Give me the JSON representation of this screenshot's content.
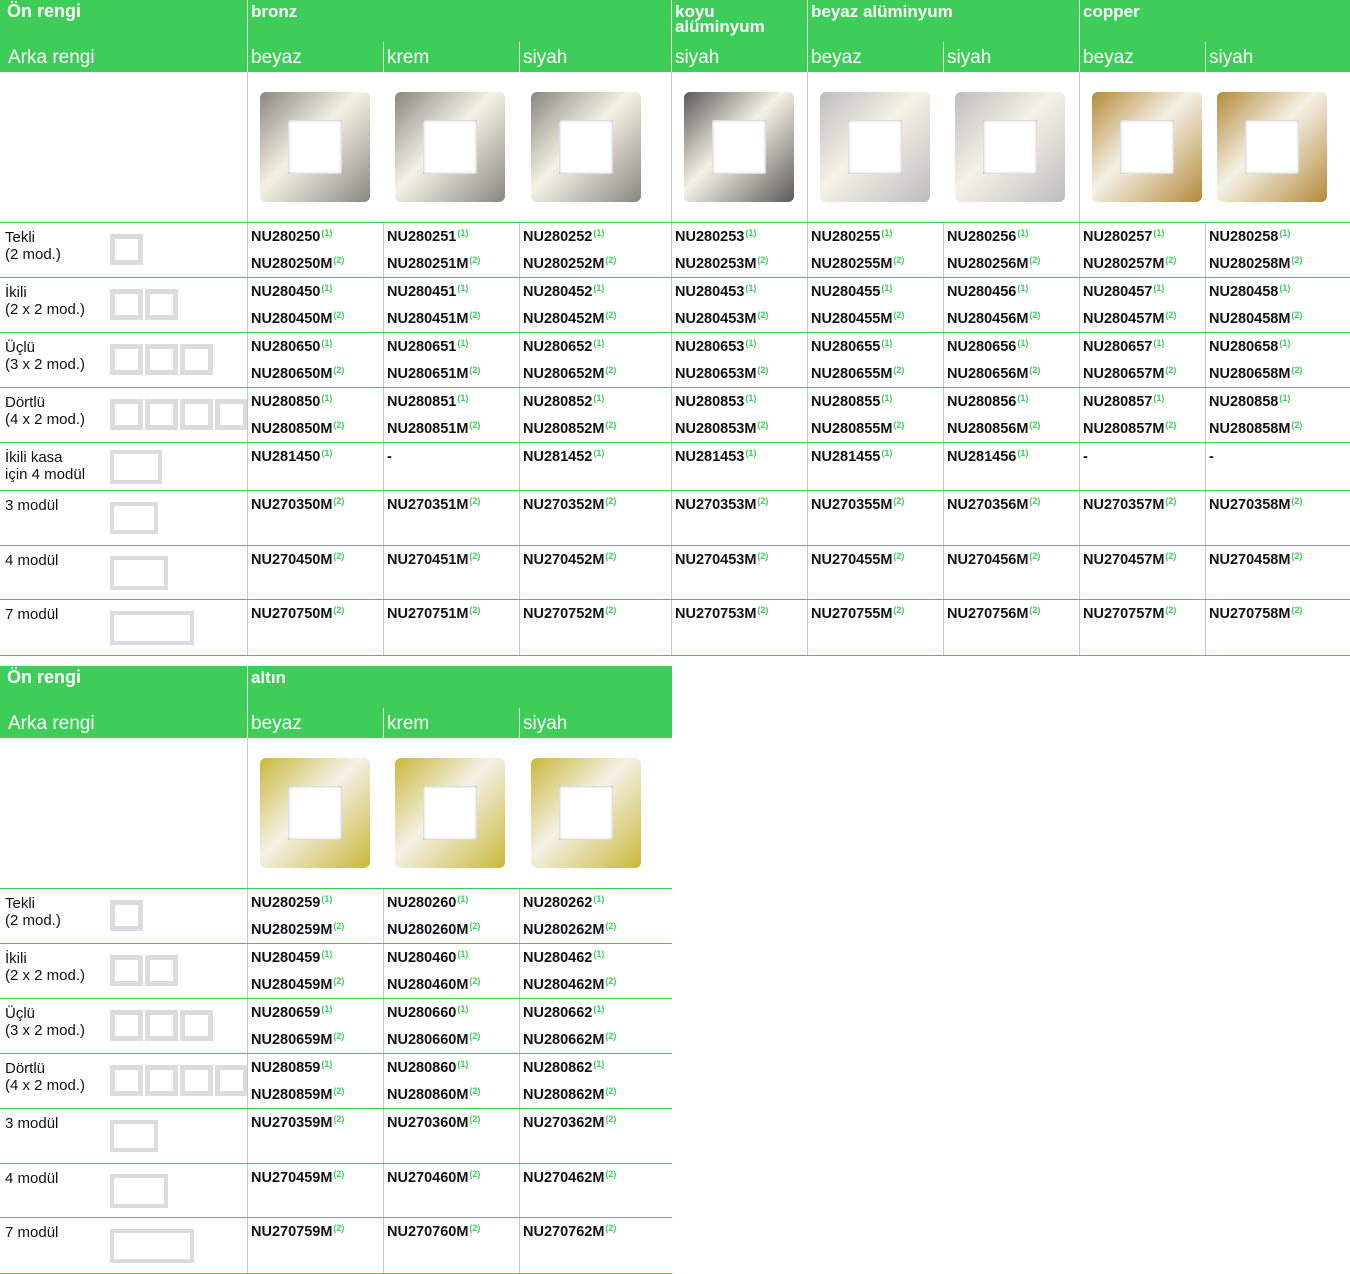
{
  "labels": {
    "front_color": "Ön rengi",
    "back_color": "Arka rengi"
  },
  "colors": {
    "brand_green": "#3dcd58",
    "bronze": "#8a8780",
    "dark_aluminium": "#5a5a57",
    "white_aluminium": "#bdbdbd",
    "copper": "#b58a3c",
    "gold": "#c8b83a"
  },
  "table1": {
    "groups": [
      {
        "name": "bronz",
        "subs": [
          "beyaz",
          "krem",
          "siyah"
        ]
      },
      {
        "name": "koyu alüminyum",
        "subs": [
          "siyah"
        ]
      },
      {
        "name": "beyaz alüminyum",
        "subs": [
          "beyaz",
          "siyah"
        ]
      },
      {
        "name": "copper",
        "subs": [
          "beyaz",
          "siyah"
        ]
      }
    ],
    "frames": [
      "bronze",
      "bronze",
      "bronze",
      "dark_aluminium",
      "white_aluminium",
      "white_aluminium",
      "copper",
      "copper"
    ],
    "rows": [
      {
        "label": "Tekli\n(2 mod.)",
        "icon": "module-icon-1x2",
        "codes": [
          [
            "NU280250",
            "NU280250M"
          ],
          [
            "NU280251",
            "NU280251M"
          ],
          [
            "NU280252",
            "NU280252M"
          ],
          [
            "NU280253",
            "NU280253M"
          ],
          [
            "NU280255",
            "NU280255M"
          ],
          [
            "NU280256",
            "NU280256M"
          ],
          [
            "NU280257",
            "NU280257M"
          ],
          [
            "NU280258",
            "NU280258M"
          ]
        ]
      },
      {
        "label": "İkili\n(2 x 2 mod.)",
        "icon": "module-icon-2x2",
        "codes": [
          [
            "NU280450",
            "NU280450M"
          ],
          [
            "NU280451",
            "NU280451M"
          ],
          [
            "NU280452",
            "NU280452M"
          ],
          [
            "NU280453",
            "NU280453M"
          ],
          [
            "NU280455",
            "NU280455M"
          ],
          [
            "NU280456",
            "NU280456M"
          ],
          [
            "NU280457",
            "NU280457M"
          ],
          [
            "NU280458",
            "NU280458M"
          ]
        ]
      },
      {
        "label": "Üçlü\n(3 x 2 mod.)",
        "icon": "module-icon-3x2",
        "codes": [
          [
            "NU280650",
            "NU280650M"
          ],
          [
            "NU280651",
            "NU280651M"
          ],
          [
            "NU280652",
            "NU280652M"
          ],
          [
            "NU280653",
            "NU280653M"
          ],
          [
            "NU280655",
            "NU280655M"
          ],
          [
            "NU280656",
            "NU280656M"
          ],
          [
            "NU280657",
            "NU280657M"
          ],
          [
            "NU280658",
            "NU280658M"
          ]
        ]
      },
      {
        "label": "Dörtlü\n(4 x 2 mod.)",
        "icon": "module-icon-4x2",
        "codes": [
          [
            "NU280850",
            "NU280850M"
          ],
          [
            "NU280851",
            "NU280851M"
          ],
          [
            "NU280852",
            "NU280852M"
          ],
          [
            "NU280853",
            "NU280853M"
          ],
          [
            "NU280855",
            "NU280855M"
          ],
          [
            "NU280856",
            "NU280856M"
          ],
          [
            "NU280857",
            "NU280857M"
          ],
          [
            "NU280858",
            "NU280858M"
          ]
        ]
      },
      {
        "label": "İkili kasa\niçin 4 modül",
        "icon": "module-icon-double-box",
        "codes": [
          [
            "NU281450"
          ],
          [
            "-"
          ],
          [
            "NU281452"
          ],
          [
            "NU281453"
          ],
          [
            "NU281455"
          ],
          [
            "NU281456"
          ],
          [
            "-"
          ],
          [
            "-"
          ]
        ]
      },
      {
        "label": "3 modül",
        "icon": "module-icon-3",
        "codes": [
          [
            "NU270350M"
          ],
          [
            "NU270351M"
          ],
          [
            "NU270352M"
          ],
          [
            "NU270353M"
          ],
          [
            "NU270355M"
          ],
          [
            "NU270356M"
          ],
          [
            "NU270357M"
          ],
          [
            "NU270358M"
          ]
        ]
      },
      {
        "label": "4 modül",
        "icon": "module-icon-4",
        "codes": [
          [
            "NU270450M"
          ],
          [
            "NU270451M"
          ],
          [
            "NU270452M"
          ],
          [
            "NU270453M"
          ],
          [
            "NU270455M"
          ],
          [
            "NU270456M"
          ],
          [
            "NU270457M"
          ],
          [
            "NU270458M"
          ]
        ]
      },
      {
        "label": "7 modül",
        "icon": "module-icon-7",
        "codes": [
          [
            "NU270750M"
          ],
          [
            "NU270751M"
          ],
          [
            "NU270752M"
          ],
          [
            "NU270753M"
          ],
          [
            "NU270755M"
          ],
          [
            "NU270756M"
          ],
          [
            "NU270757M"
          ],
          [
            "NU270758M"
          ]
        ]
      }
    ]
  },
  "table2": {
    "groups": [
      {
        "name": "altın",
        "subs": [
          "beyaz",
          "krem",
          "siyah"
        ]
      }
    ],
    "frames": [
      "gold",
      "gold",
      "gold"
    ],
    "rows": [
      {
        "label": "Tekli\n(2 mod.)",
        "icon": "module-icon-1x2",
        "codes": [
          [
            "NU280259",
            "NU280259M"
          ],
          [
            "NU280260",
            "NU280260M"
          ],
          [
            "NU280262",
            "NU280262M"
          ]
        ]
      },
      {
        "label": "İkili\n(2 x 2 mod.)",
        "icon": "module-icon-2x2",
        "codes": [
          [
            "NU280459",
            "NU280459M"
          ],
          [
            "NU280460",
            "NU280460M"
          ],
          [
            "NU280462",
            "NU280462M"
          ]
        ]
      },
      {
        "label": "Üçlü\n(3 x 2 mod.)",
        "icon": "module-icon-3x2",
        "codes": [
          [
            "NU280659",
            "NU280659M"
          ],
          [
            "NU280660",
            "NU280660M"
          ],
          [
            "NU280662",
            "NU280662M"
          ]
        ]
      },
      {
        "label": "Dörtlü\n(4 x 2 mod.)",
        "icon": "module-icon-4x2",
        "codes": [
          [
            "NU280859",
            "NU280859M"
          ],
          [
            "NU280860",
            "NU280860M"
          ],
          [
            "NU280862",
            "NU280862M"
          ]
        ]
      },
      {
        "label": "3 modül",
        "icon": "module-icon-3",
        "codes": [
          [
            "NU270359M"
          ],
          [
            "NU270360M"
          ],
          [
            "NU270362M"
          ]
        ]
      },
      {
        "label": "4 modül",
        "icon": "module-icon-4",
        "codes": [
          [
            "NU270459M"
          ],
          [
            "NU270460M"
          ],
          [
            "NU270462M"
          ]
        ]
      },
      {
        "label": "7 modül",
        "icon": "module-icon-7",
        "codes": [
          [
            "NU270759M"
          ],
          [
            "NU270760M"
          ],
          [
            "NU270762M"
          ]
        ]
      }
    ]
  }
}
